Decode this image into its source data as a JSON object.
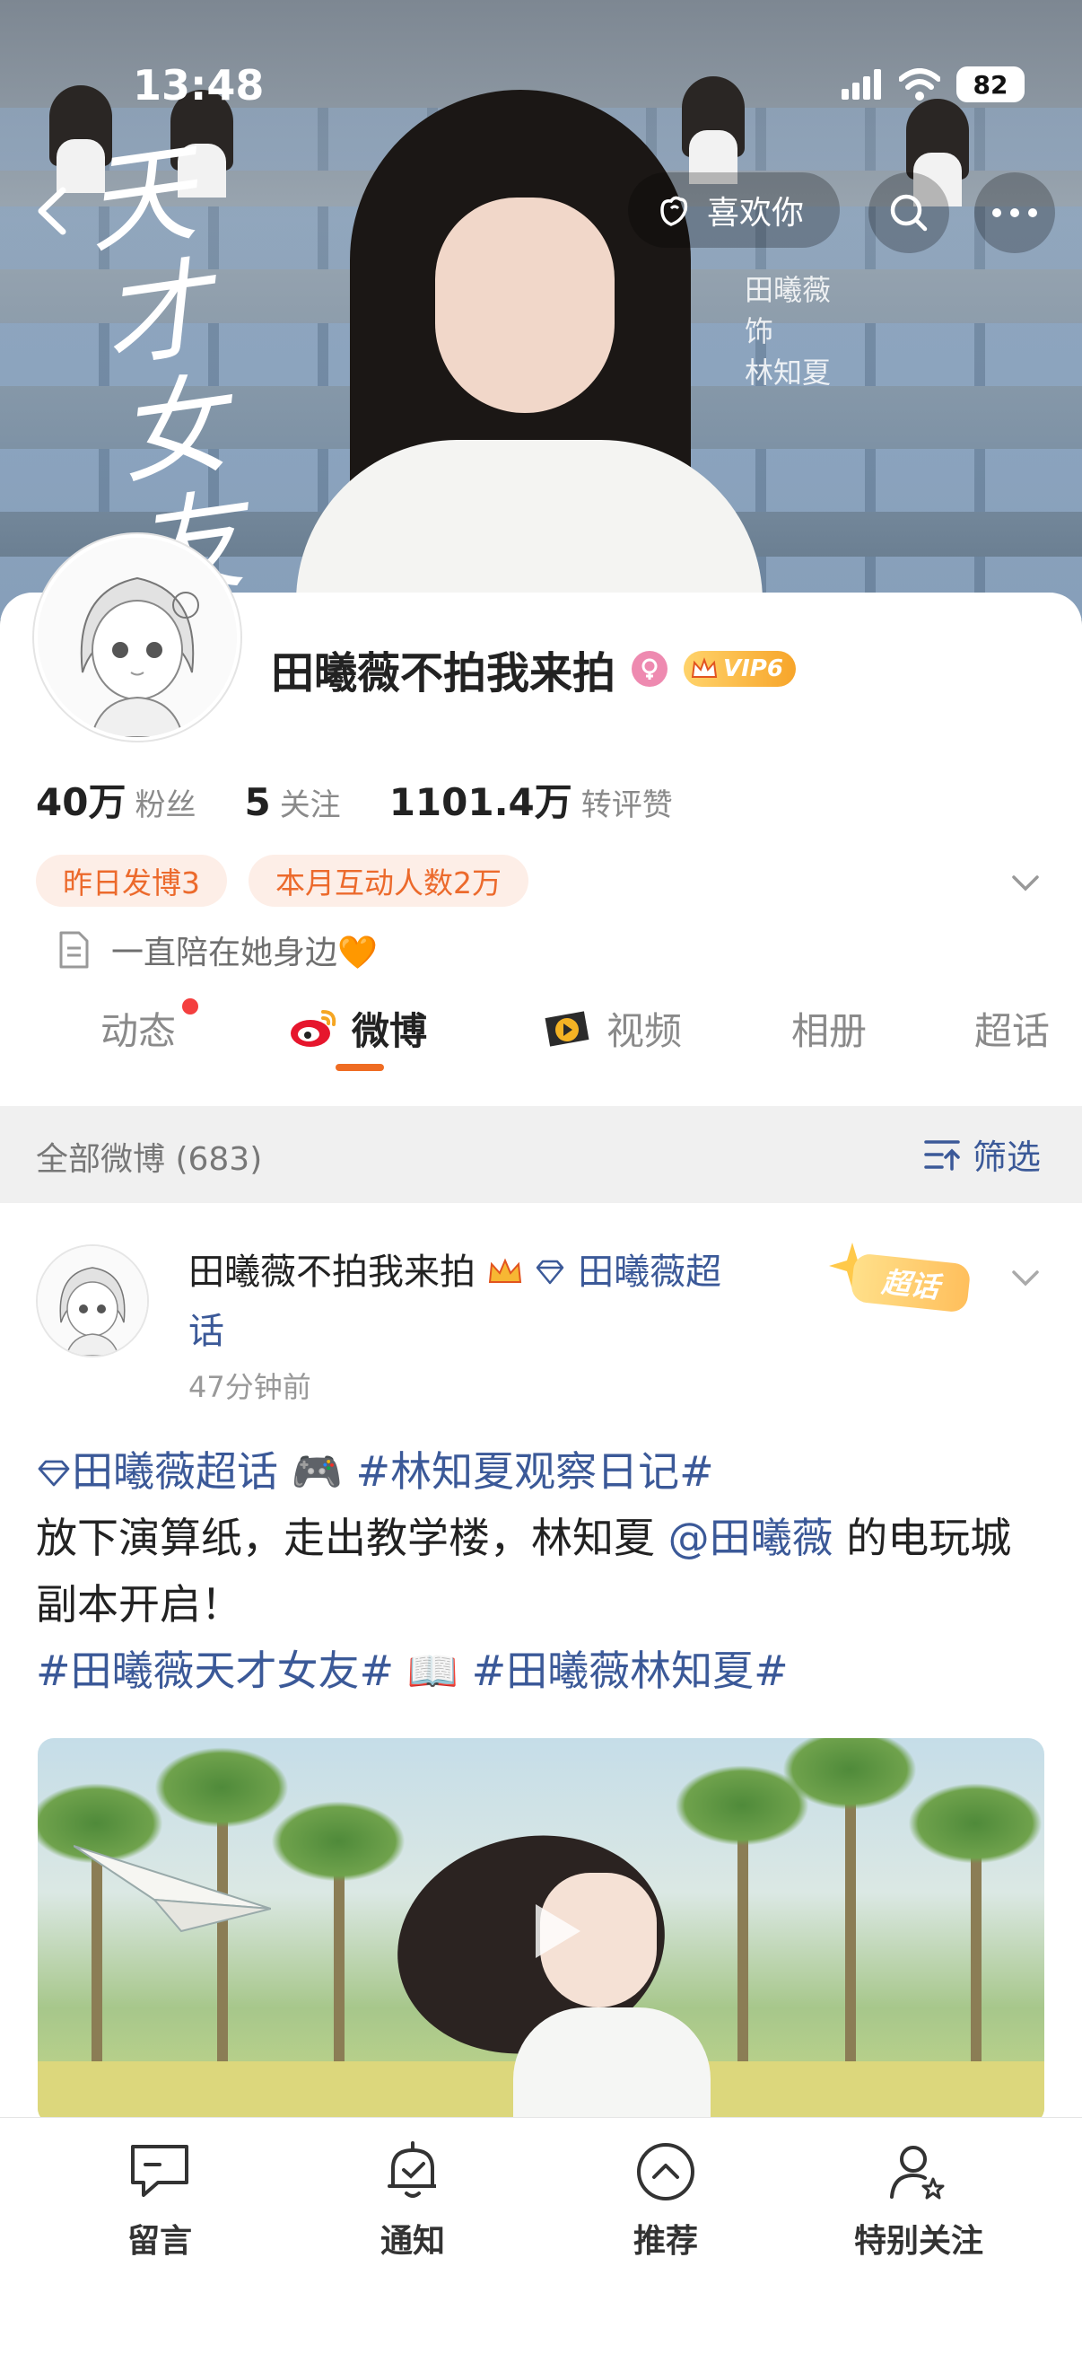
{
  "status_bar": {
    "time": "13:48",
    "battery": "82"
  },
  "banner": {
    "poster_title": "天才女友",
    "poster_credit": [
      "田曦薇",
      "饰",
      "林知夏"
    ],
    "like_label": "喜欢你"
  },
  "profile": {
    "name": "田曦薇不拍我来拍",
    "vip_label": "VIP6",
    "stats": [
      {
        "number": "40万",
        "label": "粉丝"
      },
      {
        "number": "5",
        "label": "关注"
      },
      {
        "number": "1101.4万",
        "label": "转评赞"
      }
    ],
    "chips": [
      "昨日发博3",
      "本月互动人数2万"
    ],
    "bio": "一直陪在她身边🧡"
  },
  "tabs": [
    "动态",
    "微博",
    "视频",
    "相册",
    "超话"
  ],
  "filter": {
    "title": "全部微博 (683)",
    "button": "筛选"
  },
  "post": {
    "author": "田曦薇不拍我来拍",
    "topic": "田曦薇超话",
    "time": "47分钟前",
    "badge": "超话",
    "text": {
      "topic_tag": "田曦薇超话",
      "game_emoji": "🎮",
      "hashtag1": "#林知夏观察日记#",
      "body1": "放下演算纸，走出教学楼，林知夏",
      "mention": "@田曦薇",
      "body2": " 的电玩城副本开启！",
      "hashtag2": "#田曦薇天才女友#",
      "book_emoji": "📖",
      "hashtag3": "#田曦薇林知夏#"
    }
  },
  "bottom_bar": [
    "留言",
    "通知",
    "推荐",
    "特别关注"
  ],
  "colors": {
    "accent": "#ef6c23",
    "link": "#3b5998",
    "chip_bg": "#fdeee7"
  }
}
